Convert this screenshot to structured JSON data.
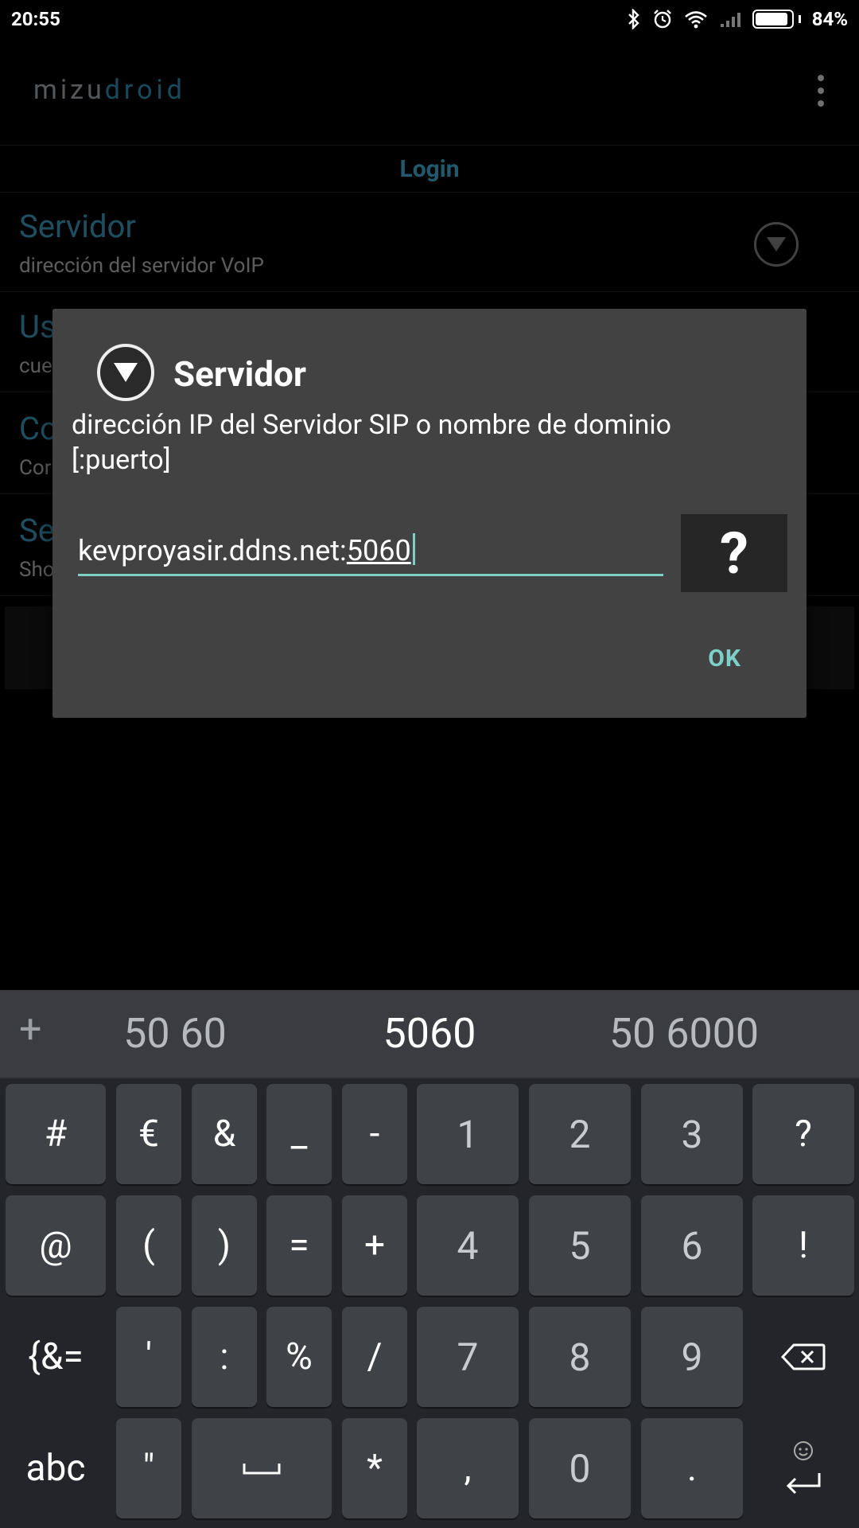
{
  "status_bar": {
    "time": "20:55",
    "battery_text": "84%",
    "battery_level": 84,
    "icons": [
      "bluetooth-icon",
      "alarm-icon",
      "wifi-icon",
      "cell-signal-icon",
      "battery-icon"
    ]
  },
  "app_bar": {
    "logo_left": "mizu",
    "logo_right": "droid",
    "menu_icon": "overflow-menu-icon"
  },
  "settings": {
    "section_title": "Login",
    "items": [
      {
        "title": "Servidor",
        "summary": "dirección del servidor VoIP"
      },
      {
        "title": "Us",
        "summary": "cue"
      },
      {
        "title": "Co",
        "summary": "Cor"
      },
      {
        "title": "Se",
        "summary": "Sho"
      }
    ]
  },
  "dialog": {
    "title": "Servidor",
    "message": "dirección IP del Servidor SIP o nombre de dominio [:puerto]",
    "input_value_prefix": "kevproyasir.ddns.net:",
    "input_value_composing": "5060",
    "help_label": "?",
    "ok_label": "OK"
  },
  "keyboard": {
    "suggestions": [
      "50 60",
      "5060",
      "50 6000"
    ],
    "plus": "+",
    "rows": [
      [
        "#",
        "€",
        "&",
        "_",
        "-",
        "1",
        "2",
        "3",
        "?"
      ],
      [
        "@",
        "(",
        ")",
        "=",
        "+",
        "4",
        "5",
        "6",
        "!"
      ],
      [
        "{&=",
        "'",
        ":",
        "%",
        "/",
        "7",
        "8",
        "9"
      ],
      [
        "abc",
        "\"",
        "*",
        ",",
        "0",
        "."
      ]
    ],
    "space_symbol": "␣"
  },
  "colors": {
    "accent_teal": "#7dd0c8",
    "pref_title_blue": "#3a8eb0",
    "dialog_bg": "#424242",
    "keyboard_bg": "#23252a"
  }
}
